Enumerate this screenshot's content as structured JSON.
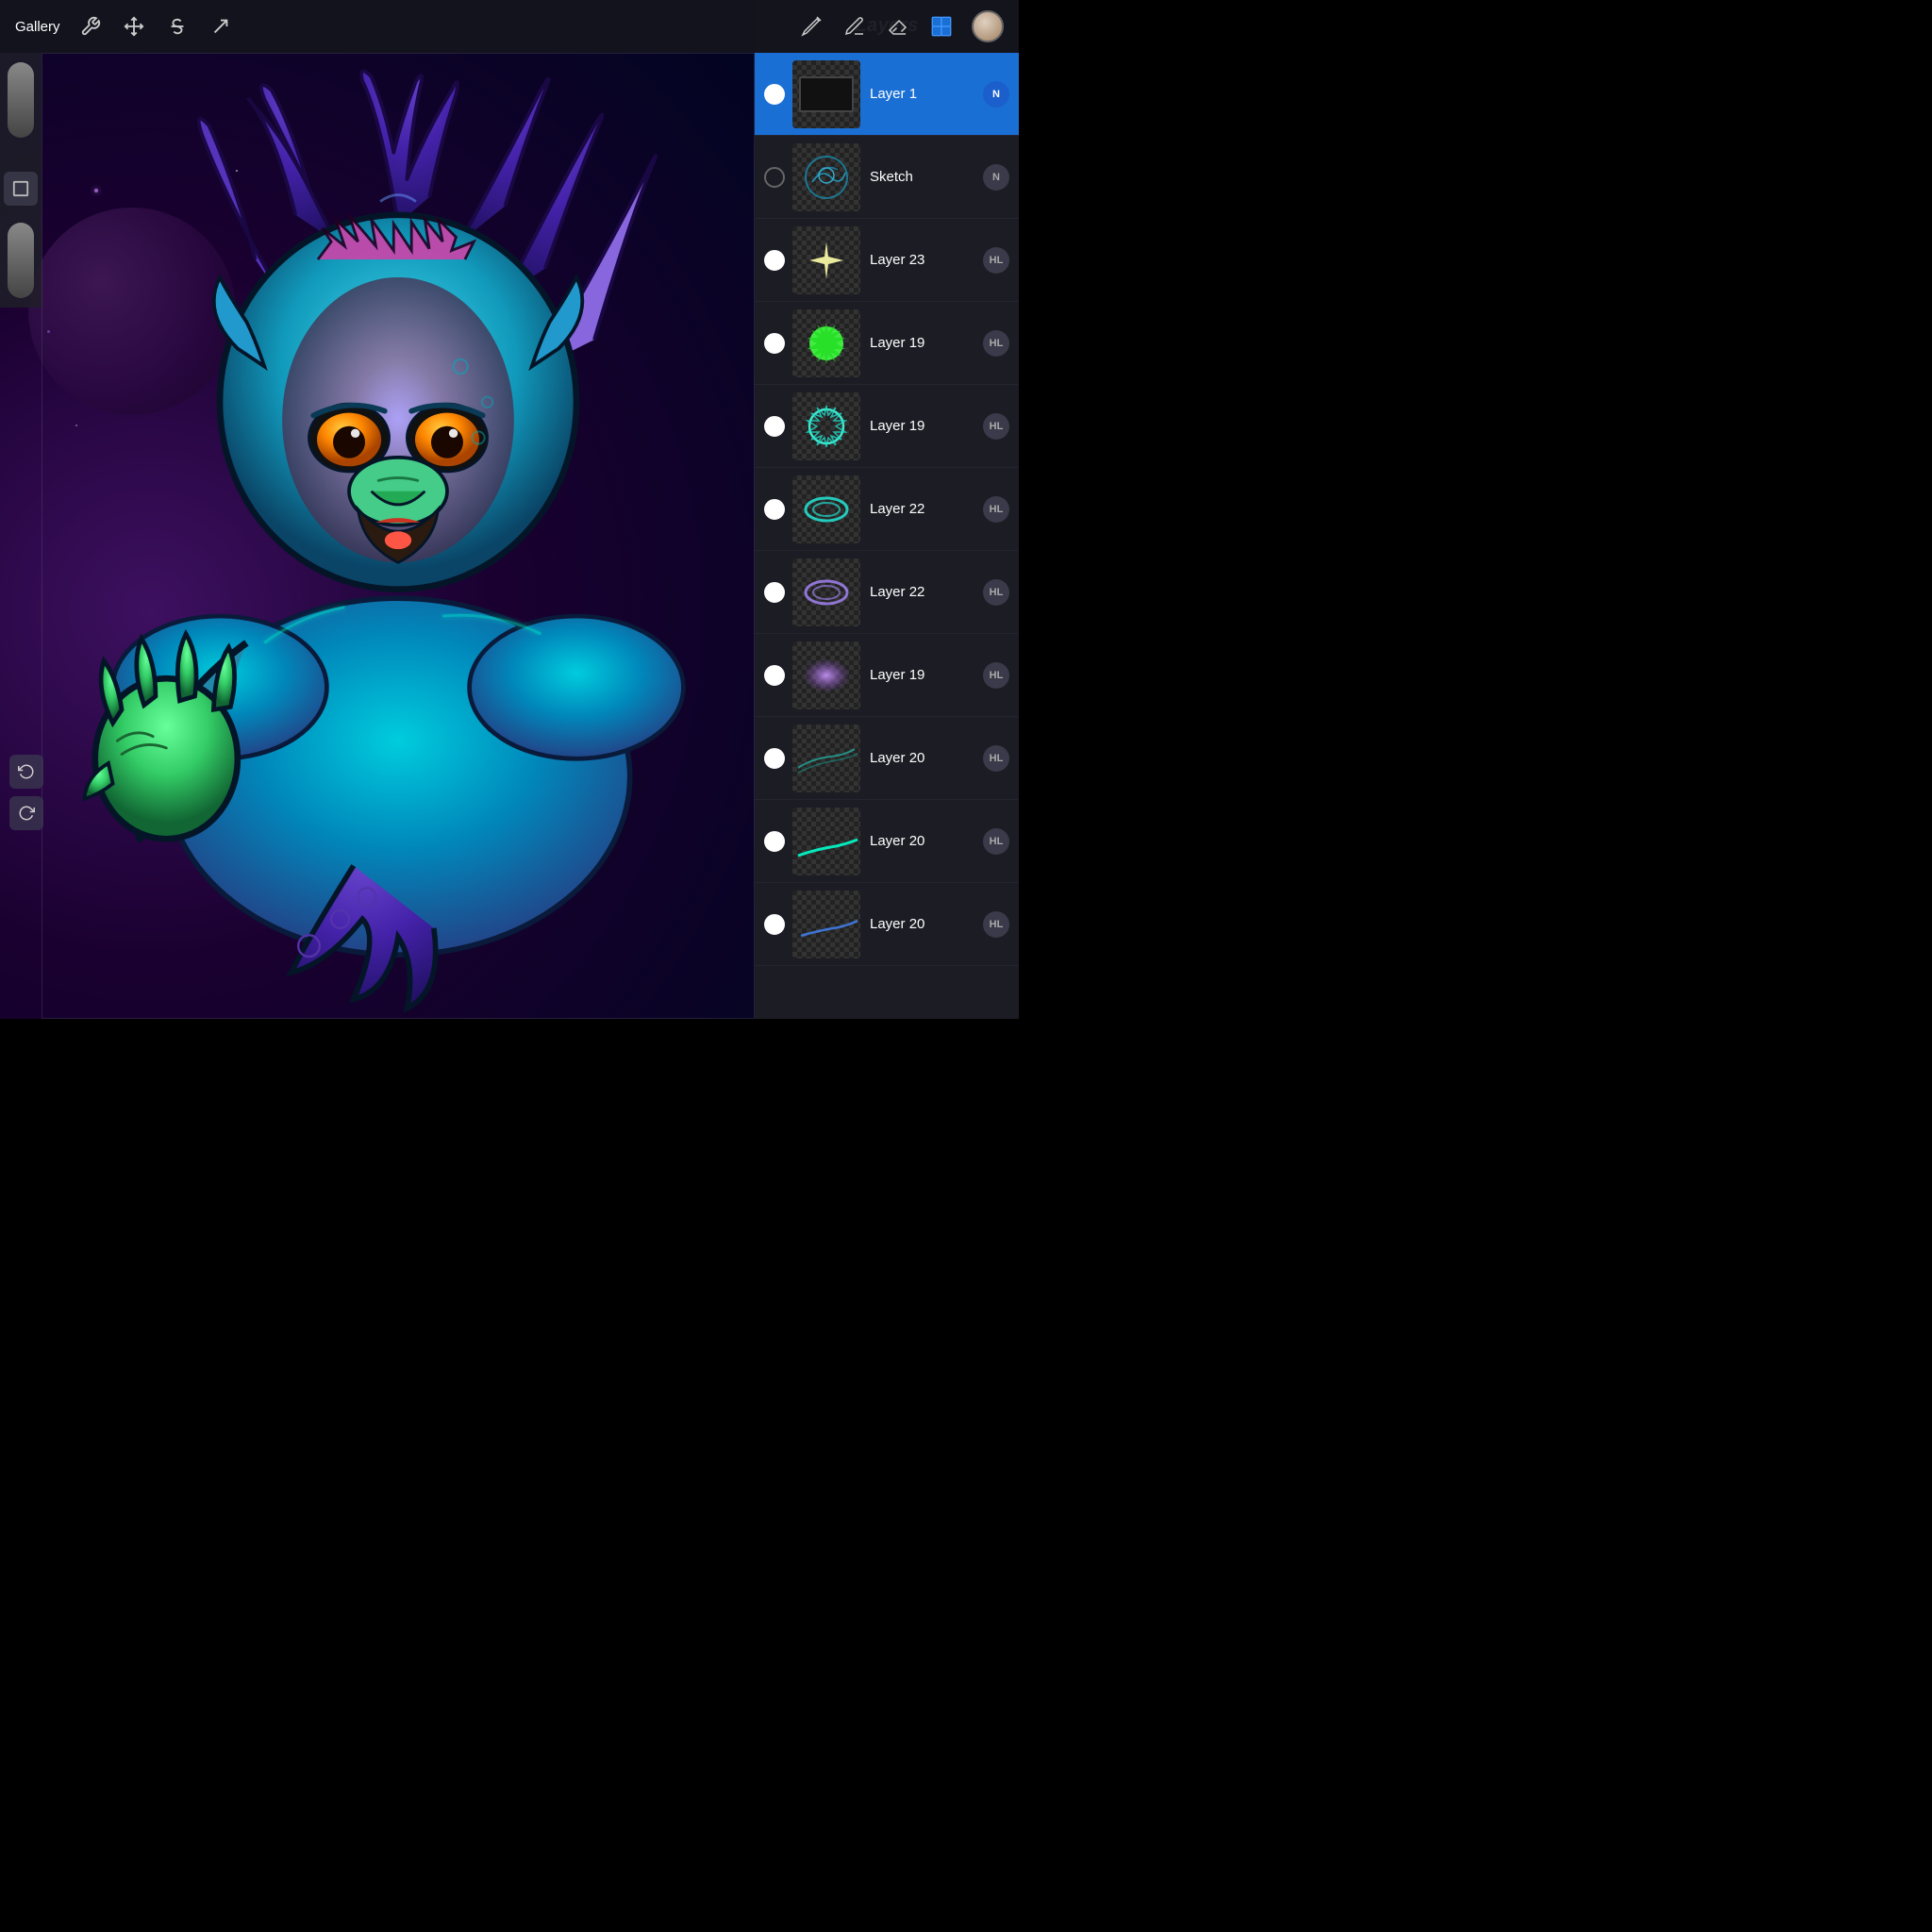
{
  "toolbar": {
    "gallery_label": "Gallery",
    "tools": [
      {
        "name": "wrench-icon",
        "symbol": "🔧"
      },
      {
        "name": "modify-icon",
        "symbol": "✦"
      },
      {
        "name": "text-icon",
        "symbol": "S̶"
      },
      {
        "name": "arrow-icon",
        "symbol": "↗"
      }
    ],
    "right_tools": [
      {
        "name": "pencil-icon",
        "symbol": "pencil"
      },
      {
        "name": "pen-icon",
        "symbol": "pen"
      },
      {
        "name": "eraser-icon",
        "symbol": "eraser"
      },
      {
        "name": "layers-icon",
        "symbol": "layers"
      },
      {
        "name": "avatar-icon",
        "symbol": "user"
      }
    ]
  },
  "layers_panel": {
    "title": "Layers",
    "add_button_label": "+",
    "layers": [
      {
        "id": 0,
        "name": "Layer 1",
        "badge": "N",
        "badge_color": "blue",
        "active": true,
        "visible": true,
        "thumb_type": "black_rect"
      },
      {
        "id": 1,
        "name": "Sketch",
        "badge": "N",
        "badge_color": "normal",
        "active": false,
        "visible": false,
        "thumb_type": "sketch"
      },
      {
        "id": 2,
        "name": "Layer 23",
        "badge": "HL",
        "badge_color": "normal",
        "active": false,
        "visible": true,
        "thumb_type": "sparkle"
      },
      {
        "id": 3,
        "name": "Layer 19",
        "badge": "HL",
        "badge_color": "normal",
        "active": false,
        "visible": true,
        "thumb_type": "green_spiky"
      },
      {
        "id": 4,
        "name": "Layer 19",
        "badge": "HL",
        "badge_color": "normal",
        "active": false,
        "visible": true,
        "thumb_type": "teal_spiky"
      },
      {
        "id": 5,
        "name": "Layer 22",
        "badge": "HL",
        "badge_color": "normal",
        "active": false,
        "visible": true,
        "thumb_type": "rings_teal"
      },
      {
        "id": 6,
        "name": "Layer 22",
        "badge": "HL",
        "badge_color": "normal",
        "active": false,
        "visible": true,
        "thumb_type": "rings_purple"
      },
      {
        "id": 7,
        "name": "Layer 19",
        "badge": "HL",
        "badge_color": "normal",
        "active": false,
        "visible": true,
        "thumb_type": "purple_glow"
      },
      {
        "id": 8,
        "name": "Layer 20",
        "badge": "HL",
        "badge_color": "normal",
        "active": false,
        "visible": true,
        "thumb_type": "teal_lines"
      },
      {
        "id": 9,
        "name": "Layer 20",
        "badge": "HL",
        "badge_color": "normal",
        "active": false,
        "visible": true,
        "thumb_type": "teal_line_bright"
      },
      {
        "id": 10,
        "name": "Layer 20",
        "badge": "HL",
        "badge_color": "normal",
        "active": false,
        "visible": true,
        "thumb_type": "blue_line"
      }
    ]
  },
  "colors": {
    "accent": "#1a6fd4",
    "background": "#1c1c24",
    "toolbar_bg": "#141420"
  }
}
